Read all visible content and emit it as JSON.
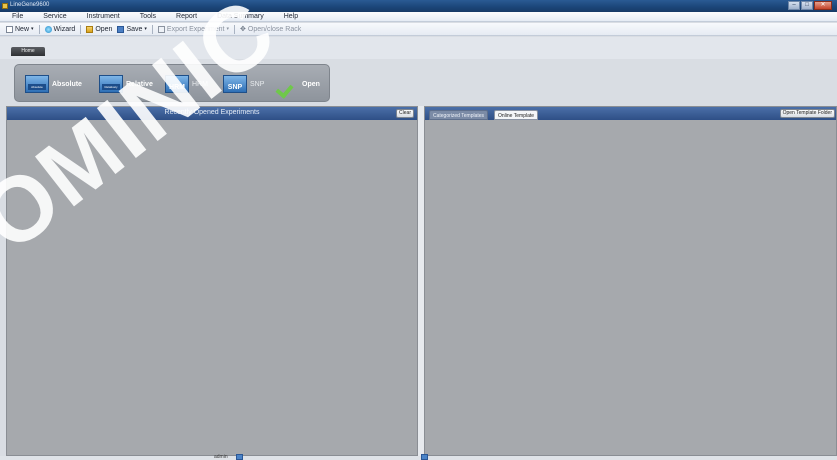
{
  "window": {
    "title": "LineGene9600",
    "controls": {
      "min": "–",
      "max": "□",
      "close": "✕"
    }
  },
  "menu": {
    "items": [
      "File",
      "Service",
      "Instrument",
      "Tools",
      "Report",
      "Data Summary",
      "Help"
    ]
  },
  "toolbar": {
    "new_label": "New",
    "wizard_label": "Wizard",
    "open_label": "Open",
    "save_label": "Save",
    "export_label": "Export Experiment",
    "rack_label": "Open/close Rack",
    "dropdown_caret": "▾",
    "rack_glyph": "✥"
  },
  "tabs": {
    "home_label": "Home"
  },
  "ribbon": {
    "absolute": {
      "icon_text": "Absolute",
      "label": "Absolute"
    },
    "relative": {
      "icon_text": "Relatively",
      "label": "Relative"
    },
    "hrm": {
      "icon_text": "HRM",
      "label": "HRM"
    },
    "snp": {
      "icon_text": "SNP",
      "label": "SNP"
    },
    "open": {
      "label": "Open"
    }
  },
  "left_panel": {
    "title": "Recently Opened Experiments",
    "clear_label": "Clear"
  },
  "right_panel": {
    "tabs": [
      "Categorized Templates",
      "Online Template"
    ],
    "active_tab": "Online Template",
    "open_folder_label": "Open Template Folder"
  },
  "status": {
    "user": "admin"
  },
  "watermark": {
    "text": "OMINIC"
  },
  "colors": {
    "titlebar": "#1b4578",
    "panel_header": "#2e4f86",
    "panel_body": "#a6a9ad",
    "ribbon": "#8e949c",
    "check": "#6fc84a"
  }
}
